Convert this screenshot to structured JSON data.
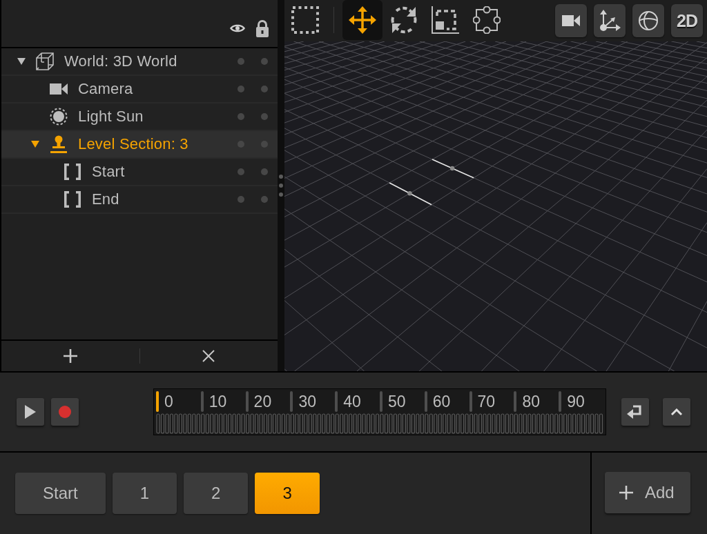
{
  "outliner": {
    "tree": [
      {
        "kind": "world",
        "label": "World: 3D World",
        "expanded": true,
        "selected": false,
        "children": [
          {
            "kind": "camera",
            "label": "Camera",
            "selected": false
          },
          {
            "kind": "light",
            "label": "Light Sun",
            "selected": false
          },
          {
            "kind": "section",
            "label": "Level Section: 3",
            "expanded": true,
            "selected": true,
            "children": [
              {
                "kind": "marker",
                "label": "Start",
                "selected": false
              },
              {
                "kind": "marker",
                "label": "End",
                "selected": false
              }
            ]
          }
        ]
      }
    ]
  },
  "viewport": {
    "tools": [
      {
        "kind": "select",
        "selected": false
      },
      {
        "kind": "move",
        "selected": true
      },
      {
        "kind": "rotate",
        "selected": false
      },
      {
        "kind": "scale",
        "selected": false
      },
      {
        "kind": "path",
        "selected": false
      }
    ],
    "view_buttons": [
      {
        "kind": "camera"
      },
      {
        "kind": "axes"
      },
      {
        "kind": "globe"
      },
      {
        "kind": "text",
        "label": "2D"
      }
    ]
  },
  "timeline": {
    "level": 0,
    "ticks": [
      "0",
      "10",
      "20",
      "30",
      "40",
      "50",
      "60",
      "70",
      "80",
      "90"
    ]
  },
  "sections": {
    "tabs": [
      {
        "label": "Start",
        "selected": false
      },
      {
        "label": "1",
        "selected": false
      },
      {
        "label": "2",
        "selected": false
      },
      {
        "label": "3",
        "selected": true
      }
    ],
    "add_button": {
      "label": "Add"
    }
  }
}
